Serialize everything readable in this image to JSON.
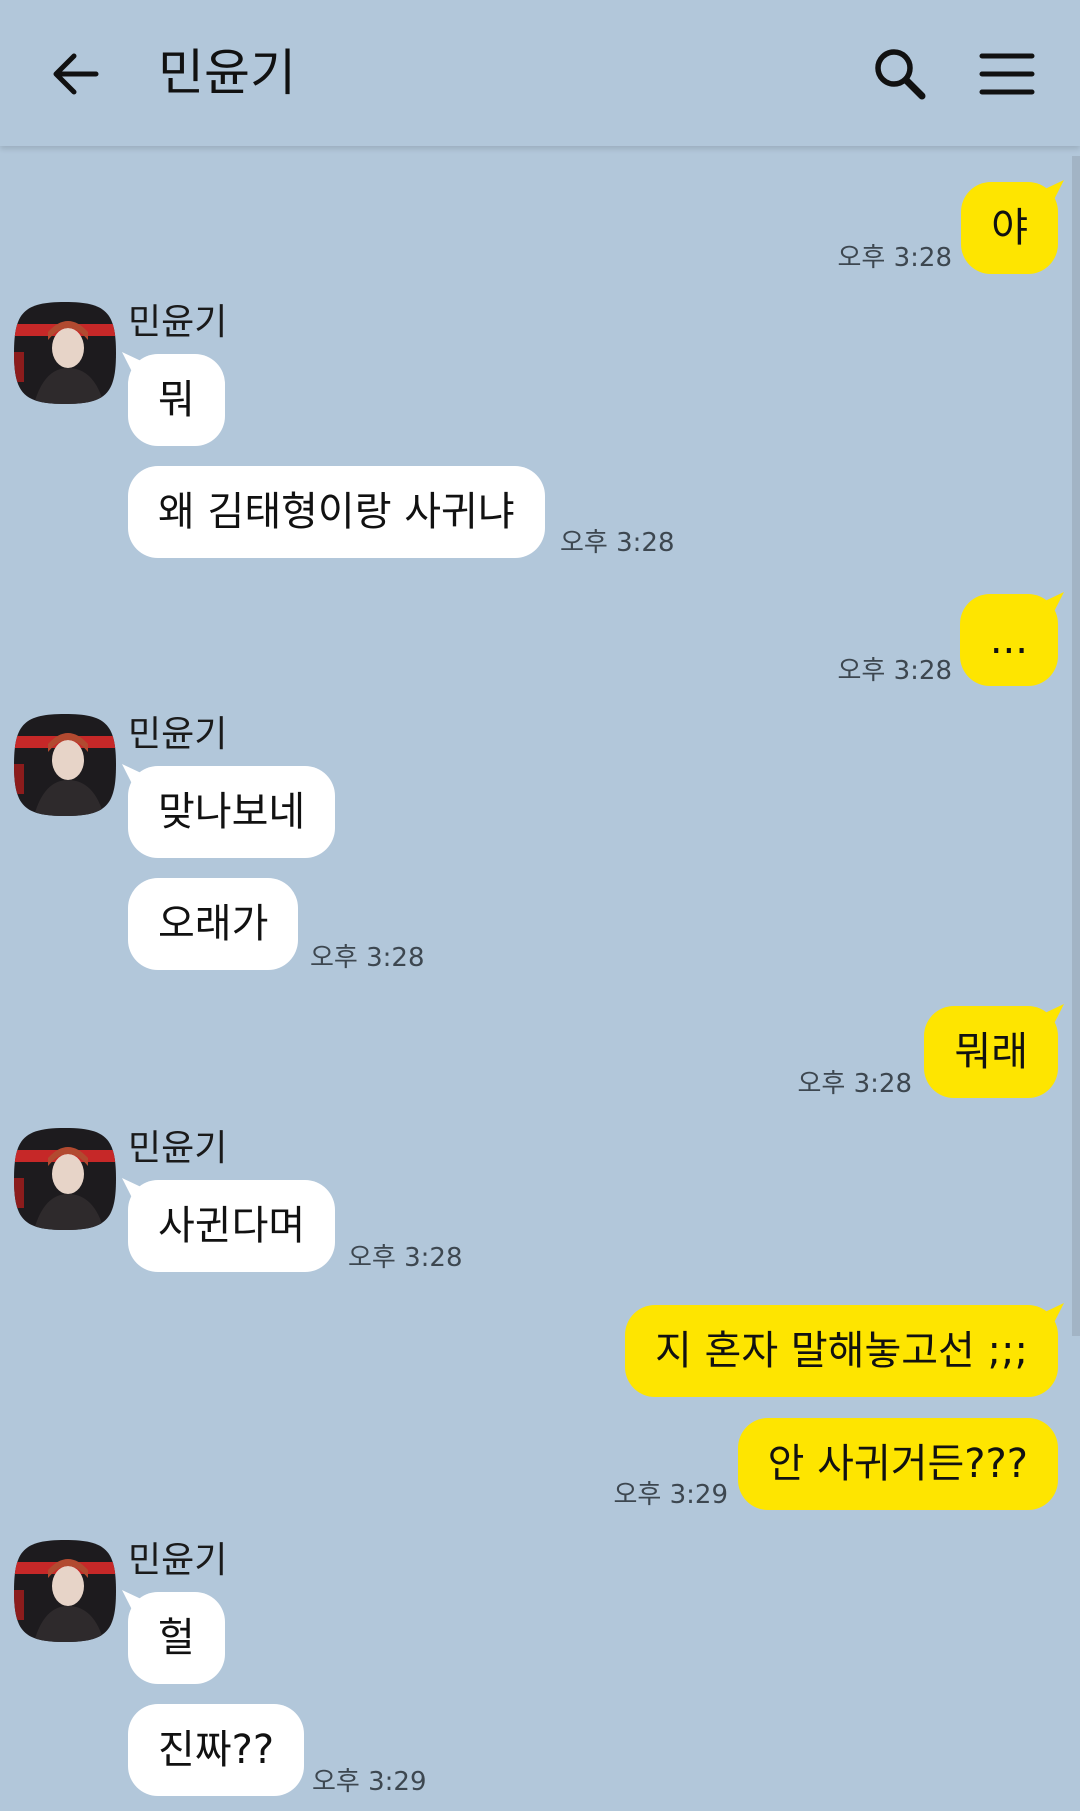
{
  "header": {
    "title": "민윤기",
    "back_icon": "back-arrow-icon",
    "search_icon": "search-icon",
    "menu_icon": "menu-icon"
  },
  "colors": {
    "background": "#b2c7da",
    "outgoing_bubble": "#fee500",
    "incoming_bubble": "#ffffff"
  },
  "contact": {
    "name": "민윤기",
    "avatar": "avatar-photo"
  },
  "messages": [
    {
      "direction": "outgoing",
      "text": "야",
      "time": "오후 3:28"
    },
    {
      "direction": "incoming",
      "sender": "민윤기",
      "text": "뭐"
    },
    {
      "direction": "incoming",
      "text": "왜 김태형이랑 사귀냐",
      "time": "오후 3:28"
    },
    {
      "direction": "outgoing",
      "text": "...",
      "time": "오후 3:28"
    },
    {
      "direction": "incoming",
      "sender": "민윤기",
      "text": "맞나보네"
    },
    {
      "direction": "incoming",
      "text": "오래가",
      "time": "오후 3:28"
    },
    {
      "direction": "outgoing",
      "text": "뭐래",
      "time": "오후 3:28"
    },
    {
      "direction": "incoming",
      "sender": "민윤기",
      "text": "사귄다며",
      "time": "오후 3:28"
    },
    {
      "direction": "outgoing",
      "text": "지 혼자 말해놓고선 ;;;"
    },
    {
      "direction": "outgoing",
      "text": "안 사귀거든???",
      "time": "오후 3:29"
    },
    {
      "direction": "incoming",
      "sender": "민윤기",
      "text": "헐"
    },
    {
      "direction": "incoming",
      "text": "진짜??",
      "time": "오후 3:29"
    }
  ]
}
